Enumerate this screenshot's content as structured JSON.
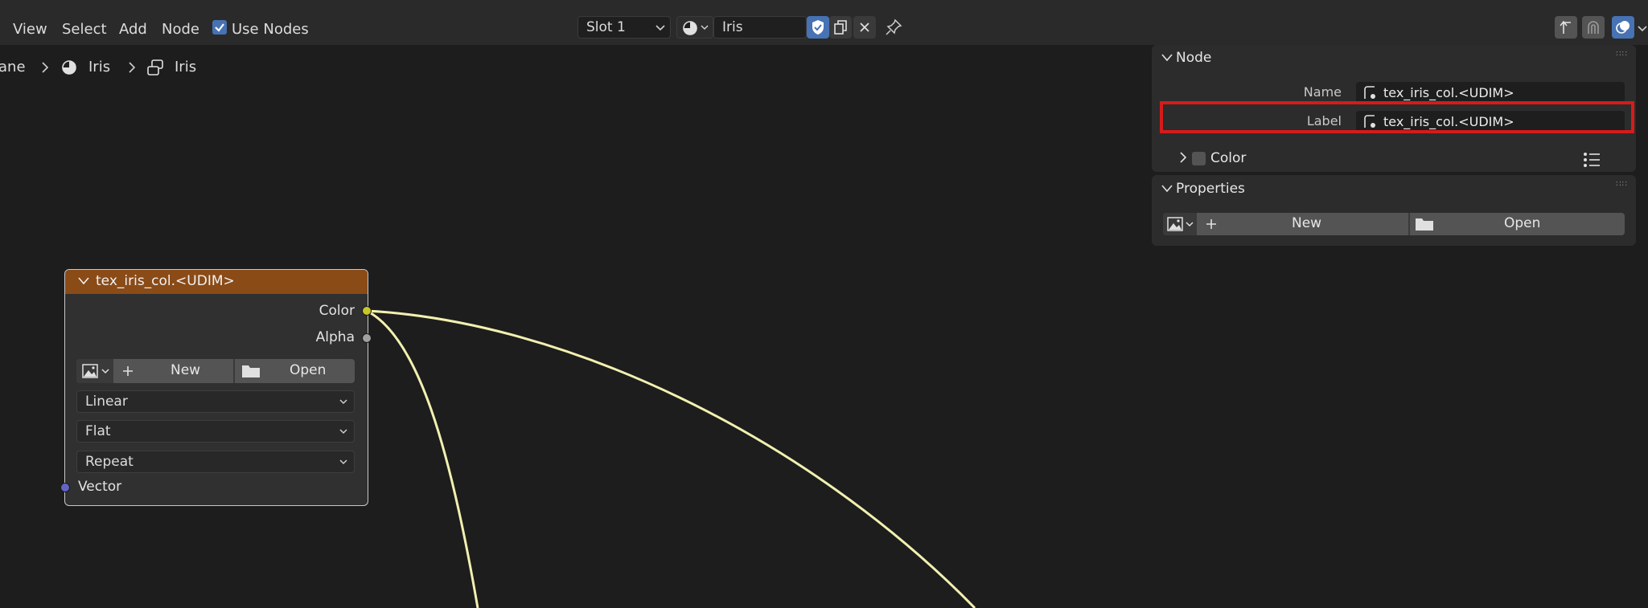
{
  "menu": {
    "view": "View",
    "select": "Select",
    "add": "Add",
    "node": "Node",
    "use_nodes": "Use Nodes"
  },
  "header": {
    "slot": "Slot 1",
    "material": "Iris"
  },
  "breadcrumb": {
    "part0": "ane",
    "part1": "Iris",
    "part2": "Iris"
  },
  "node": {
    "title": "tex_iris_col.<UDIM>",
    "out_color": "Color",
    "out_alpha": "Alpha",
    "new_label": "New",
    "open_label": "Open",
    "interpolation": "Linear",
    "projection": "Flat",
    "extension": "Repeat",
    "in_vector": "Vector",
    "header_color": "#8a4b17"
  },
  "sidebar": {
    "node_panel": {
      "title": "Node",
      "name_label": "Name",
      "name_value": "tex_iris_col.<UDIM>",
      "label_label": "Label",
      "label_value": "tex_iris_col.<UDIM>",
      "color_label": "Color"
    },
    "properties_panel": {
      "title": "Properties",
      "new_label": "New",
      "open_label": "Open"
    }
  },
  "colors": {
    "link": "#f2f0b0",
    "socket_color": "#c7c729",
    "socket_alpha": "#a0a0a0",
    "socket_vector": "#6363c7",
    "accent": "#4772b3",
    "highlight": "#d61b1b"
  }
}
